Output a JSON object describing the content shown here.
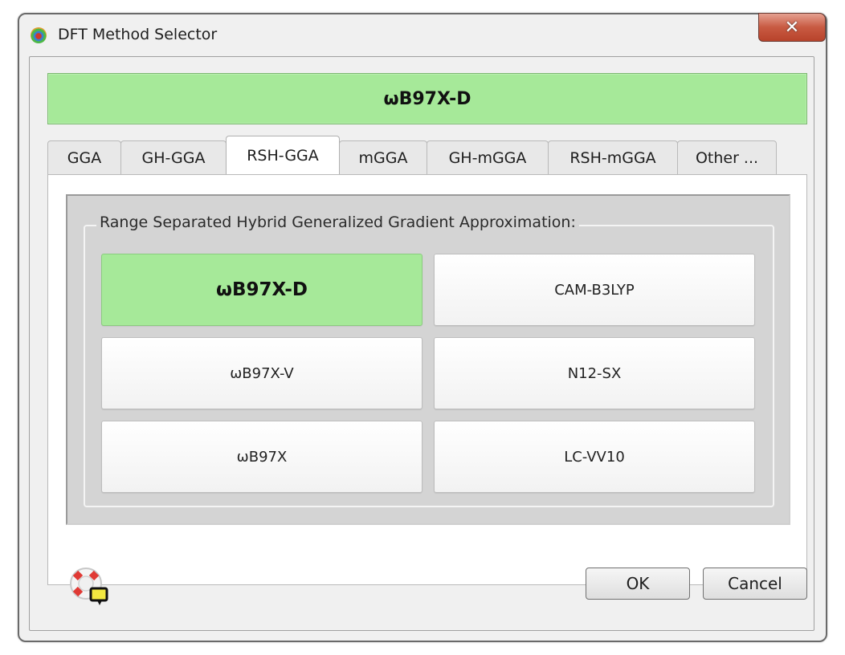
{
  "window": {
    "title": "DFT Method Selector",
    "icon": "app-logo-icon",
    "close_label": "✕"
  },
  "selected_method": "ωB97X-D",
  "tabs": [
    {
      "label": "GGA",
      "active": false
    },
    {
      "label": "GH-GGA",
      "active": false
    },
    {
      "label": "RSH-GGA",
      "active": true
    },
    {
      "label": "mGGA",
      "active": false
    },
    {
      "label": "GH-mGGA",
      "active": false
    },
    {
      "label": "RSH-mGGA",
      "active": false
    },
    {
      "label": "Other ...",
      "active": false
    }
  ],
  "group": {
    "label": "Range Separated Hybrid Generalized Gradient Approximation:",
    "methods": [
      {
        "label": "ωB97X-D",
        "selected": true
      },
      {
        "label": "CAM-B3LYP",
        "selected": false
      },
      {
        "label": "ωB97X-V",
        "selected": false
      },
      {
        "label": "N12-SX",
        "selected": false
      },
      {
        "label": "ωB97X",
        "selected": false
      },
      {
        "label": "LC-VV10",
        "selected": false
      }
    ]
  },
  "colors": {
    "selected_green": "#a6e999",
    "close_red": "#c85a42"
  },
  "footer": {
    "help_icon": "lifebuoy-help-icon",
    "ok_label": "OK",
    "cancel_label": "Cancel"
  }
}
